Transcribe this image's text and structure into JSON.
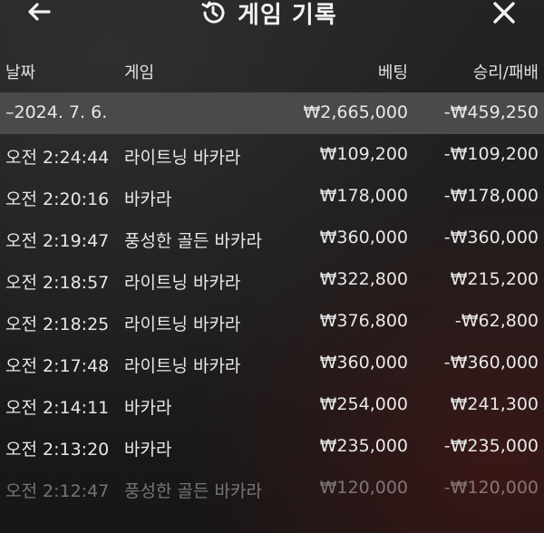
{
  "header": {
    "title": "게임 기록",
    "back_icon": "arrow-left-icon",
    "history_icon": "history-icon",
    "close_icon": "close-icon"
  },
  "columns": {
    "date": "날짜",
    "game": "게임",
    "bet": "베팅",
    "win_loss": "승리/패배"
  },
  "summary": {
    "date": "–2024. 7. 6.",
    "bet": "₩2,665,000",
    "win_loss": "-₩459,250"
  },
  "rows": [
    {
      "time": "오전 2:24:44",
      "game": "라이트닝 바카라",
      "bet": "₩109,200",
      "win_loss": "-₩109,200"
    },
    {
      "time": "오전 2:20:16",
      "game": "바카라",
      "bet": "₩178,000",
      "win_loss": "-₩178,000"
    },
    {
      "time": "오전 2:19:47",
      "game": "풍성한 골든 바카라",
      "bet": "₩360,000",
      "win_loss": "-₩360,000"
    },
    {
      "time": "오전 2:18:57",
      "game": "라이트닝 바카라",
      "bet": "₩322,800",
      "win_loss": "₩215,200"
    },
    {
      "time": "오전 2:18:25",
      "game": "라이트닝 바카라",
      "bet": "₩376,800",
      "win_loss": "-₩62,800"
    },
    {
      "time": "오전 2:17:48",
      "game": "라이트닝 바카라",
      "bet": "₩360,000",
      "win_loss": "-₩360,000"
    },
    {
      "time": "오전 2:14:11",
      "game": "바카라",
      "bet": "₩254,000",
      "win_loss": "₩241,300"
    },
    {
      "time": "오전 2:13:20",
      "game": "바카라",
      "bet": "₩235,000",
      "win_loss": "-₩235,000"
    },
    {
      "time": "오전 2:12:47",
      "game": "풍성한 골든 바카라",
      "bet": "₩120,000",
      "win_loss": "-₩120,000"
    }
  ]
}
